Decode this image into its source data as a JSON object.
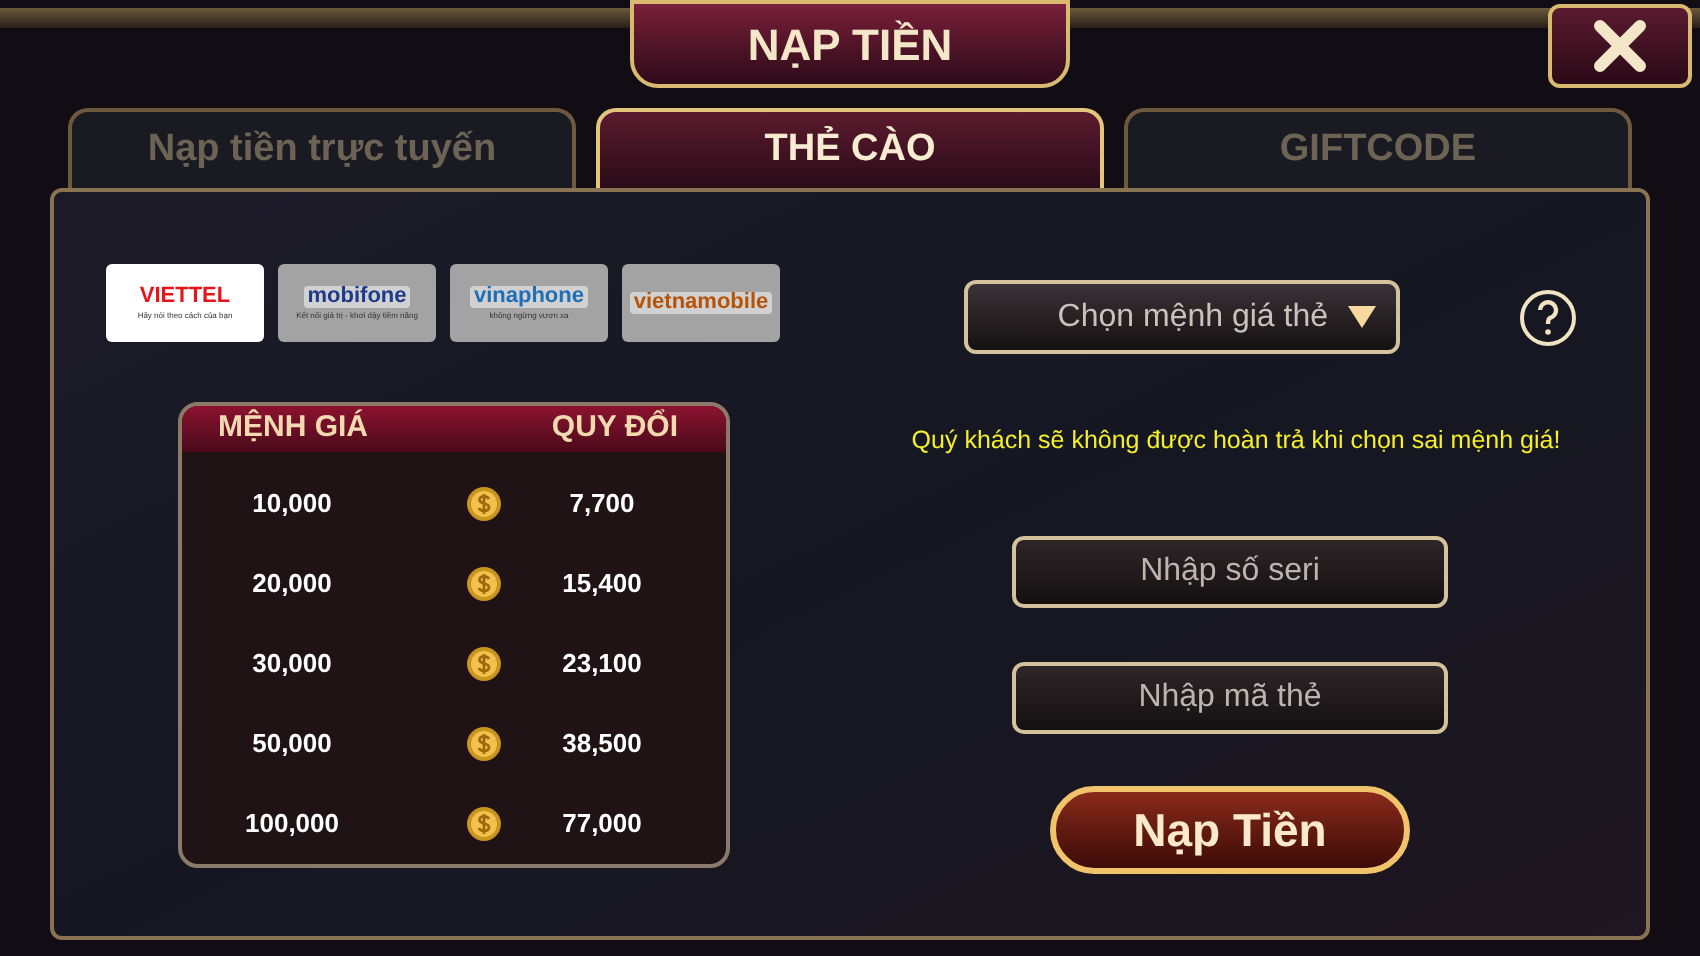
{
  "window": {
    "title": "NẠP TIỀN"
  },
  "tabs": [
    {
      "label": "Nạp tiền trực tuyến",
      "selected": false
    },
    {
      "label": "THẺ CÀO",
      "selected": true
    },
    {
      "label": "GIFTCODE",
      "selected": false
    }
  ],
  "carriers": [
    {
      "name": "VIETTEL",
      "tagline": "Hãy nói theo cách của bạn",
      "selected": true,
      "color": "#e8141b"
    },
    {
      "name": "mobifone",
      "tagline": "Kết nối giá trị - khơi dậy tiềm năng",
      "selected": false,
      "color": "#1e3a8a"
    },
    {
      "name": "vinaphone",
      "tagline": "không ngừng vươn xa",
      "selected": false,
      "color": "#1e6fb8"
    },
    {
      "name": "vietnamobile",
      "selected": false,
      "color": "#b45309"
    }
  ],
  "table": {
    "columns": [
      "MỆNH GIÁ",
      "QUY ĐỔI"
    ],
    "rows": [
      {
        "value": "10,000",
        "exchange": "7,700"
      },
      {
        "value": "20,000",
        "exchange": "15,400"
      },
      {
        "value": "30,000",
        "exchange": "23,100"
      },
      {
        "value": "50,000",
        "exchange": "38,500"
      },
      {
        "value": "100,000",
        "exchange": "77,000"
      }
    ]
  },
  "denomination_select": {
    "placeholder": "Chọn mệnh giá thẻ"
  },
  "warning": "Quý khách sẽ không được hoàn trả khi chọn sai mệnh giá!",
  "serial_field": {
    "placeholder": "Nhập số seri"
  },
  "code_field": {
    "placeholder": "Nhập mã thẻ"
  },
  "submit_button": "Nạp Tiền"
}
